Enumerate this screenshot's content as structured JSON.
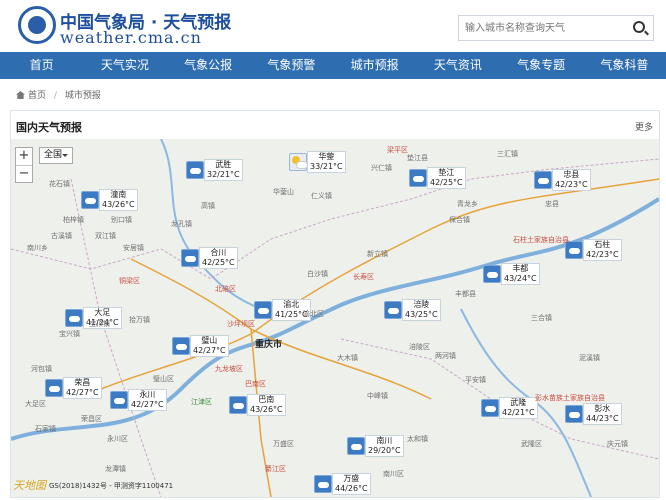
{
  "header": {
    "title": "中国气象局 · 天气预报",
    "subtitle": "weather.cma.cn",
    "search_placeholder": "输入城市名称查询天气"
  },
  "nav": [
    "首页",
    "天气实况",
    "气象公报",
    "气象预警",
    "城市预报",
    "天气资讯",
    "气象专题",
    "气象科普"
  ],
  "breadcrumb": {
    "home": "首页",
    "sep": "/",
    "current": "城市预报"
  },
  "panel": {
    "title": "国内天气预报",
    "more": "更多"
  },
  "map": {
    "zoom_in": "+",
    "zoom_out": "−",
    "select_value": "全国",
    "main_city": "重庆市",
    "copyright": "GS(2018)1432号 - 甲测资字1100471",
    "watermark": "天地图",
    "cities": [
      {
        "name": "武胜",
        "temp": "32/21°C",
        "icon": "rain-icon"
      },
      {
        "name": "华蓥",
        "temp": "33/21°C",
        "icon": "sun-cloud-icon"
      },
      {
        "name": "垫江",
        "temp": "42/25°C",
        "icon": "cloud-icon"
      },
      {
        "name": "忠县",
        "temp": "42/23°C",
        "icon": "cloud-icon"
      },
      {
        "name": "潼南",
        "temp": "43/26°C",
        "icon": "rain-icon"
      },
      {
        "name": "合川",
        "temp": "42/25°C",
        "icon": "rain-icon"
      },
      {
        "name": "石柱",
        "temp": "42/23°C",
        "icon": "rain-icon"
      },
      {
        "name": "丰都",
        "temp": "43/24°C",
        "icon": "cloud-icon"
      },
      {
        "name": "大足",
        "temp": "41/24°C",
        "icon": "rain-icon"
      },
      {
        "name": "渝北",
        "temp": "41/25°C",
        "icon": "cloud-icon"
      },
      {
        "name": "涪陵",
        "temp": "43/25°C",
        "icon": "cloud-icon"
      },
      {
        "name": "璧山",
        "temp": "42/27°C",
        "icon": "cloud-icon"
      },
      {
        "name": "荣昌",
        "temp": "42/27°C",
        "icon": "cloud-icon"
      },
      {
        "name": "永川",
        "temp": "42/27°C",
        "icon": "rain-icon"
      },
      {
        "name": "巴南",
        "temp": "43/26°C",
        "icon": "cloud-icon"
      },
      {
        "name": "武隆",
        "temp": "42/21°C",
        "icon": "cloud-icon"
      },
      {
        "name": "彭水",
        "temp": "44/23°C",
        "icon": "cloud-icon"
      },
      {
        "name": "南川",
        "temp": "29/20°C",
        "icon": "rain-icon"
      },
      {
        "name": "万盛",
        "temp": "44/26°C",
        "icon": "cloud-icon"
      }
    ],
    "labels": [
      "花石镇",
      "柏梓镇",
      "古溪镇",
      "双江镇",
      "别口镇",
      "安居镇",
      "南川乡",
      "宝兴镇",
      "河包镇",
      "拾万镇",
      "宝顶镇",
      "铜梁区",
      "北碚区",
      "沙坪坝区",
      "九龙坡区",
      "江津区",
      "綦江区",
      "巴南区",
      "长寿区",
      "大足区",
      "荣昌区",
      "永川区",
      "璧山区",
      "渝北区",
      "涪陵区",
      "武隆区",
      "南川区",
      "万盛区",
      "丰都县",
      "忠县",
      "垫江县",
      "石柱土家族自治县",
      "彭水苗族土家族自治县",
      "华蓥山",
      "兴仁镇",
      "仁义镇",
      "三汇镇",
      "新立镇",
      "龙孔镇",
      "高镇",
      "白沙镇",
      "三合镇",
      "大木镇",
      "中峰镇",
      "两河镇",
      "保合镇",
      "泥溪镇",
      "庆元镇",
      "青龙乡",
      "龙潭镇",
      "石家镇",
      "太和镇",
      "平安镇",
      "梁平区"
    ]
  }
}
